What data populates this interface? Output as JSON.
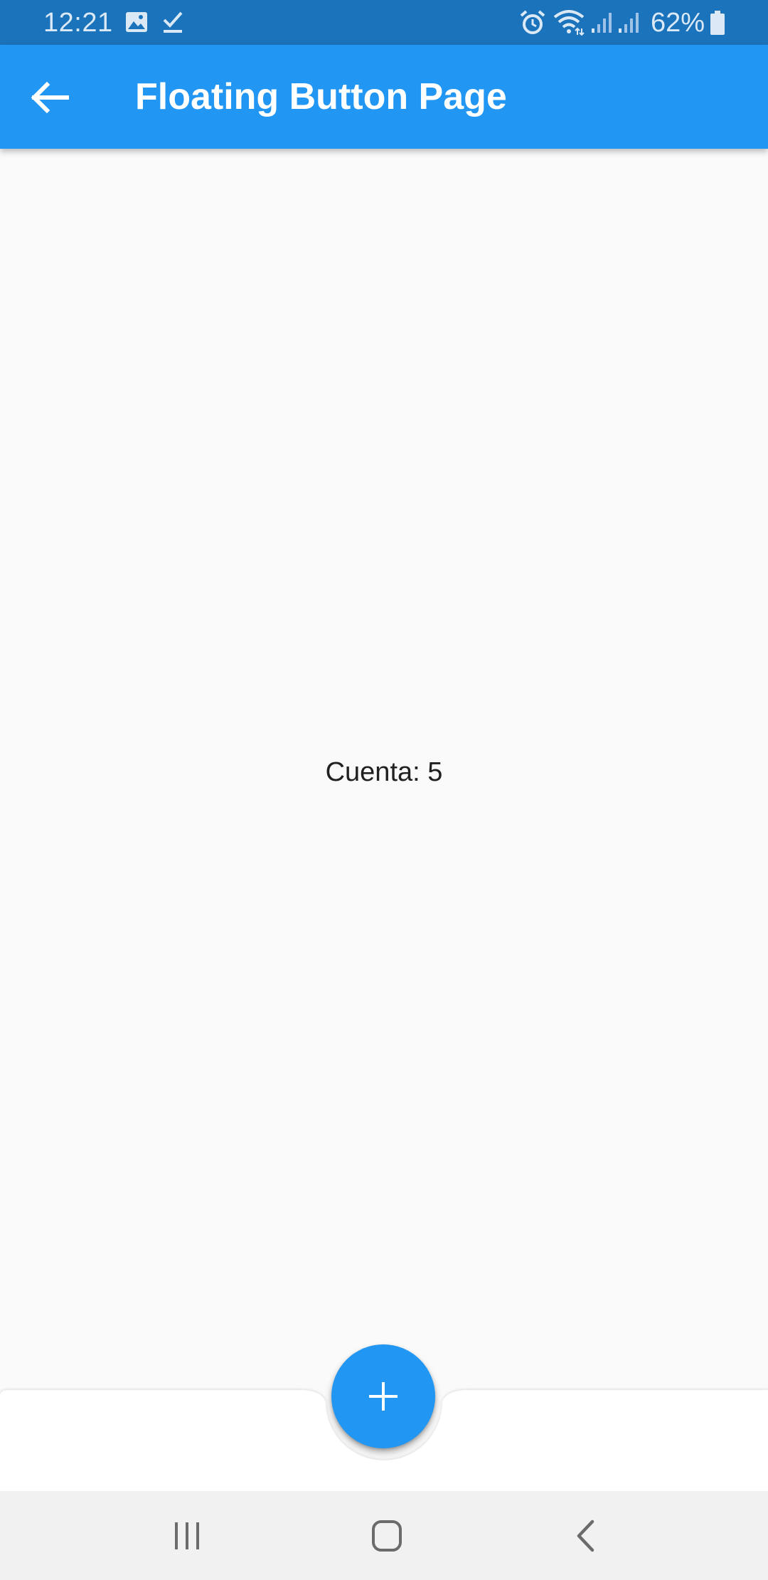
{
  "status_bar": {
    "time": "12:21",
    "battery_percent": "62%",
    "background_color": "#1a73bb",
    "icons": [
      "gallery-icon",
      "check-icon",
      "alarm-icon",
      "wifi-icon",
      "signal-icon",
      "signal-icon",
      "battery-icon"
    ]
  },
  "app_bar": {
    "title": "Floating Button Page",
    "back_icon": "arrow-back-icon",
    "background_color": "#2196f3"
  },
  "body": {
    "counter_text": "Cuenta: 5"
  },
  "fab": {
    "icon": "add-icon",
    "background_color": "#2196f3"
  },
  "nav_bar": {
    "buttons": [
      "recent-apps-icon",
      "home-icon",
      "back-icon"
    ]
  }
}
